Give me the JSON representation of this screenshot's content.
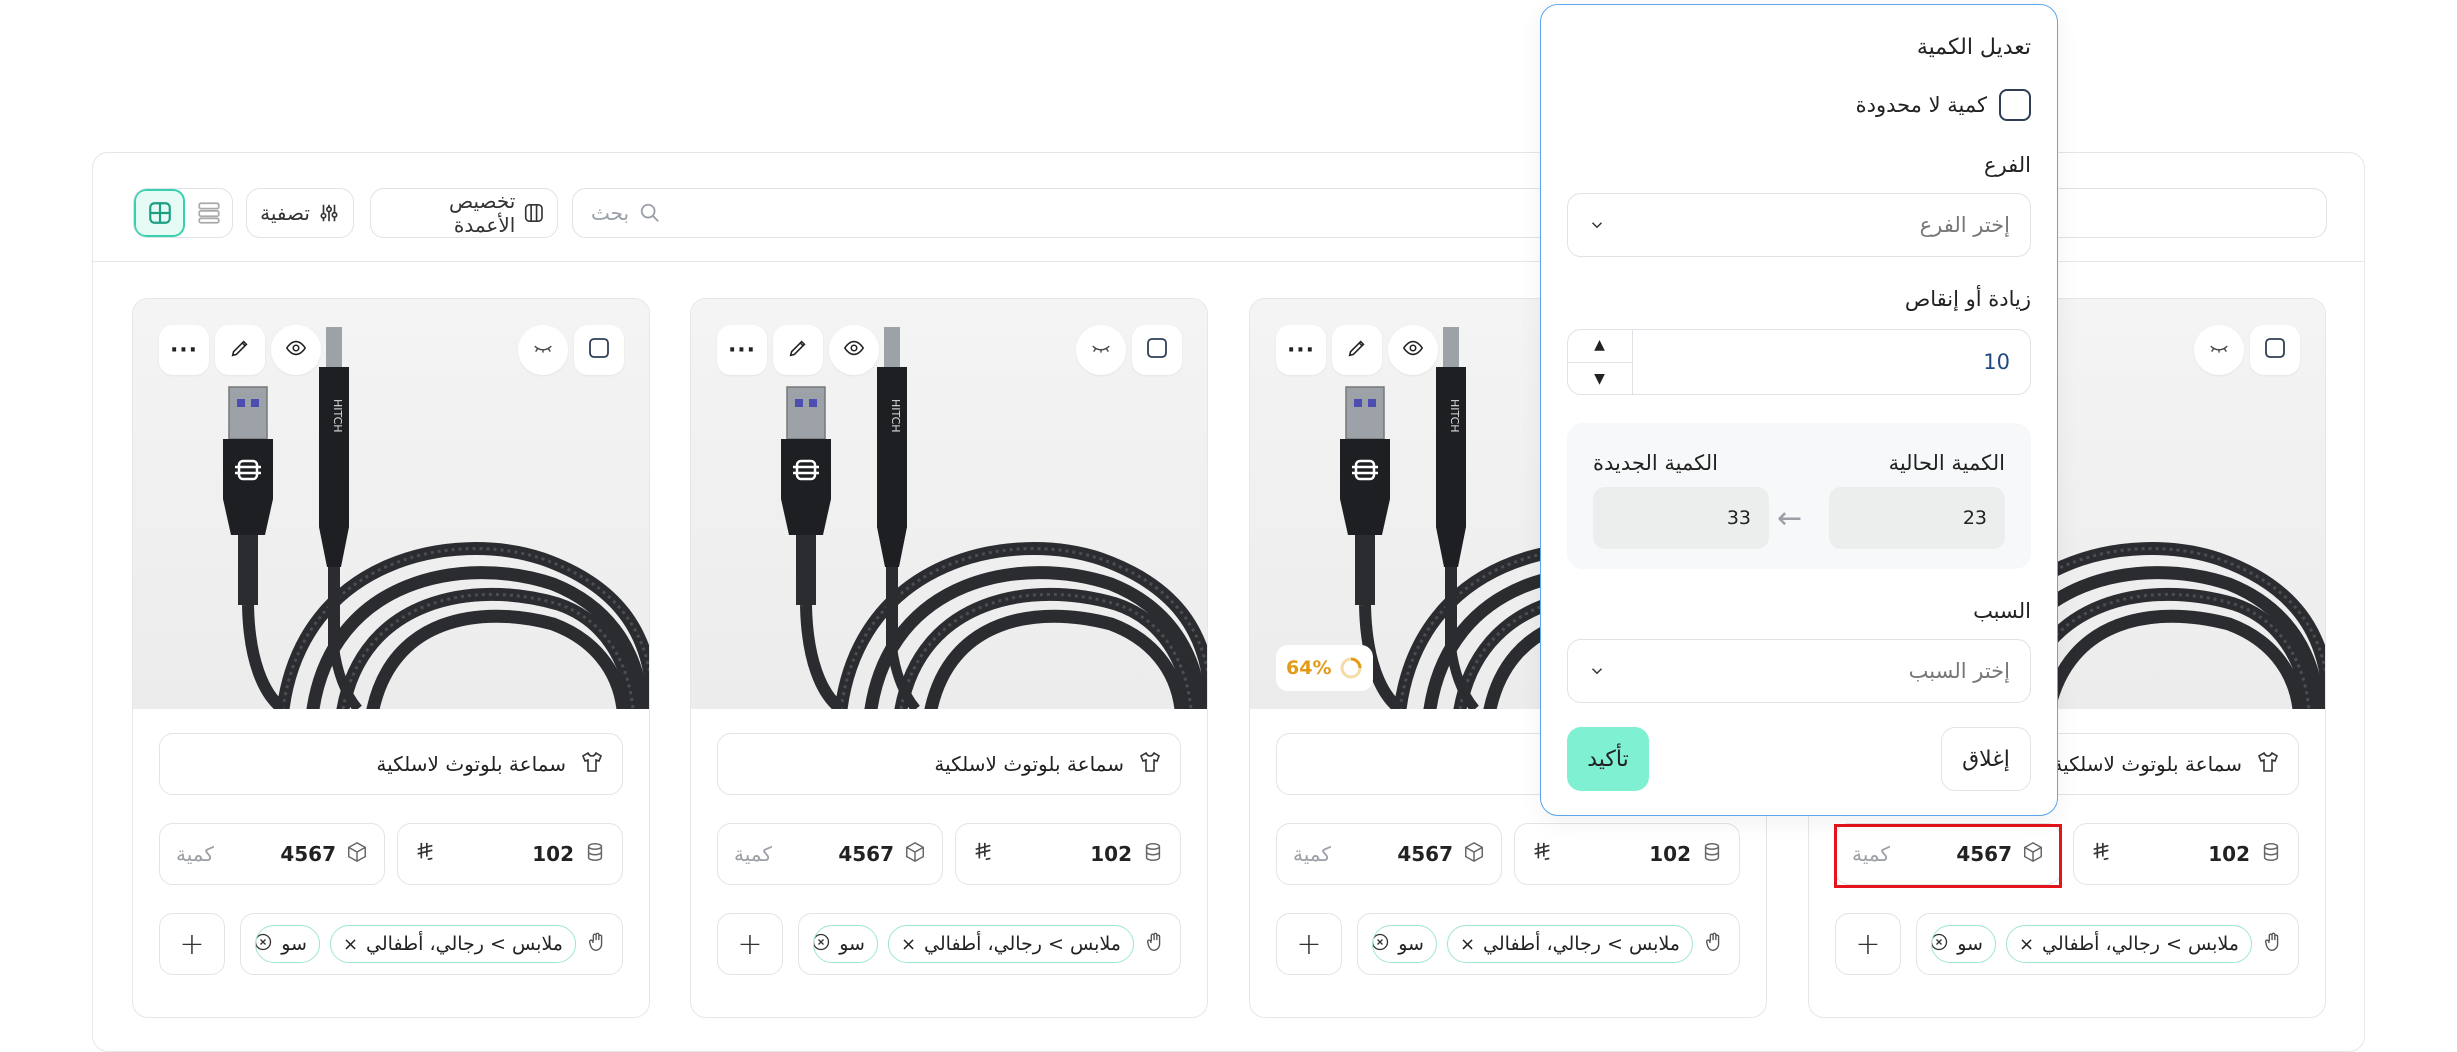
{
  "toolbar": {
    "search_placeholder": "بحث",
    "customize_columns": "تخصيص الأعمدة",
    "filter": "تصفية"
  },
  "card": {
    "title": "سماعة بلوتوث لاسلكية",
    "title_partial": "كبة",
    "price": "102",
    "quantity": "4567",
    "quantity_label": "كمية",
    "tag_category": "ملابس > رجالي، أطفالي",
    "tag_short": "سو",
    "badge": "64%",
    "cable_brand": "HITCH"
  },
  "popup": {
    "title": "تعديل الكمية",
    "unlimited": "كمية لا محدودة",
    "branch_label": "الفرع",
    "branch_placeholder": "إختر الفرع",
    "adjust_label": "زيادة أو إنقاص",
    "adjust_value": "10",
    "current_label": "الكمية الحالية",
    "new_label": "الكمية الجديدة",
    "current_value": "23",
    "new_value": "33",
    "arrow": "←",
    "reason_label": "السبب",
    "reason_placeholder": "إختر السبب",
    "confirm": "تأكيد",
    "close": "إغلاق"
  },
  "colors": {
    "accent": "#36d1ad",
    "confirm_bg": "#7ff0d2",
    "popup_border": "#5aa7ef",
    "highlight": "#e3141b",
    "badge": "#e49a16"
  }
}
